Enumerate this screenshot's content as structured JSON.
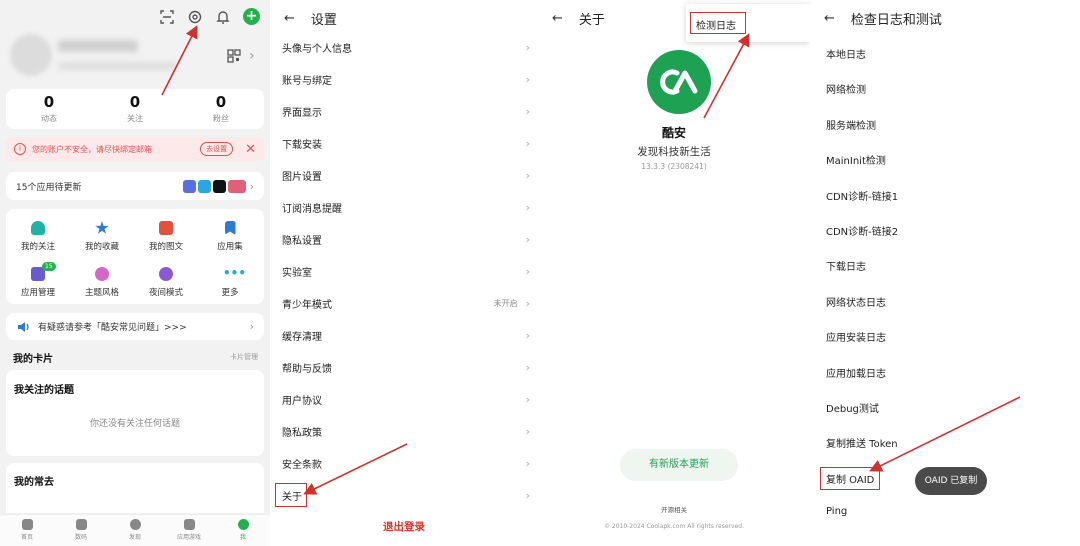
{
  "profile": {
    "stats": [
      {
        "value": "0",
        "label": "动态"
      },
      {
        "value": "0",
        "label": "关注"
      },
      {
        "value": "0",
        "label": "粉丝"
      }
    ],
    "warning_text": "您的账户不安全，请尽快绑定邮箱",
    "warning_button": "去设置",
    "updates_text": "15个应用待更新",
    "grid": [
      {
        "label": "我的关注",
        "color": "#1fb2a5"
      },
      {
        "label": "我的收藏",
        "color": "#2e7bd6"
      },
      {
        "label": "我的图文",
        "color": "#e0523d"
      },
      {
        "label": "应用集",
        "color": "#2e7bd6"
      },
      {
        "label": "应用管理",
        "color": "#6a5acd",
        "badge": "15"
      },
      {
        "label": "主题风格",
        "color": "#d468c8"
      },
      {
        "label": "夜间模式",
        "color": "#8a5ad6"
      },
      {
        "label": "更多",
        "color": "#2aa7d6"
      }
    ],
    "faq_text": "有疑惑请参考「酷安常见问题」>>>",
    "my_card_title": "我的卡片",
    "card_manage": "卡片管理",
    "topics_title": "我关注的话题",
    "topics_empty": "你还没有关注任何话题",
    "often_title": "我的常去",
    "tabs": [
      {
        "label": "首页",
        "active": false
      },
      {
        "label": "数码",
        "active": false
      },
      {
        "label": "发现",
        "active": false
      },
      {
        "label": "应用游戏",
        "active": false
      },
      {
        "label": "我",
        "active": true
      }
    ]
  },
  "settings": {
    "title": "设置",
    "rows": [
      {
        "label": "头像与个人信息"
      },
      {
        "label": "账号与绑定"
      },
      {
        "label": "界面显示"
      },
      {
        "label": "下载安装"
      },
      {
        "label": "图片设置"
      },
      {
        "label": "订阅消息提醒"
      },
      {
        "label": "隐私设置"
      },
      {
        "label": "实验室"
      },
      {
        "label": "青少年模式",
        "value": "未开启"
      },
      {
        "label": "缓存清理"
      },
      {
        "label": "帮助与反馈"
      },
      {
        "label": "用户协议"
      },
      {
        "label": "隐私政策"
      },
      {
        "label": "安全条款"
      },
      {
        "label": "关于"
      }
    ],
    "logout": "退出登录"
  },
  "about": {
    "title": "关于",
    "menu_item": "检测日志",
    "app_name": "酷安",
    "slogan": "发现科技新生活",
    "version": "13.3.3 (2308241)",
    "new_version_button": "有新版本更新",
    "open_source": "开源相关",
    "copyright": "© 2010-2024 Coolapk.com All rights reserved."
  },
  "logs": {
    "title": "检查日志和测试",
    "items": [
      "本地日志",
      "网络检测",
      "服务端检测",
      "MainInit检测",
      "CDN诊断-链接1",
      "CDN诊断-链接2",
      "下载日志",
      "网络状态日志",
      "应用安装日志",
      "应用加载日志",
      "Debug测试",
      "复制推送 Token",
      "复制 OAID",
      "Ping"
    ],
    "toast": "OAID 已复制"
  },
  "colors": {
    "accent": "#23b14d",
    "highlight_red": "#d0312d",
    "warning_red": "#e05050"
  }
}
